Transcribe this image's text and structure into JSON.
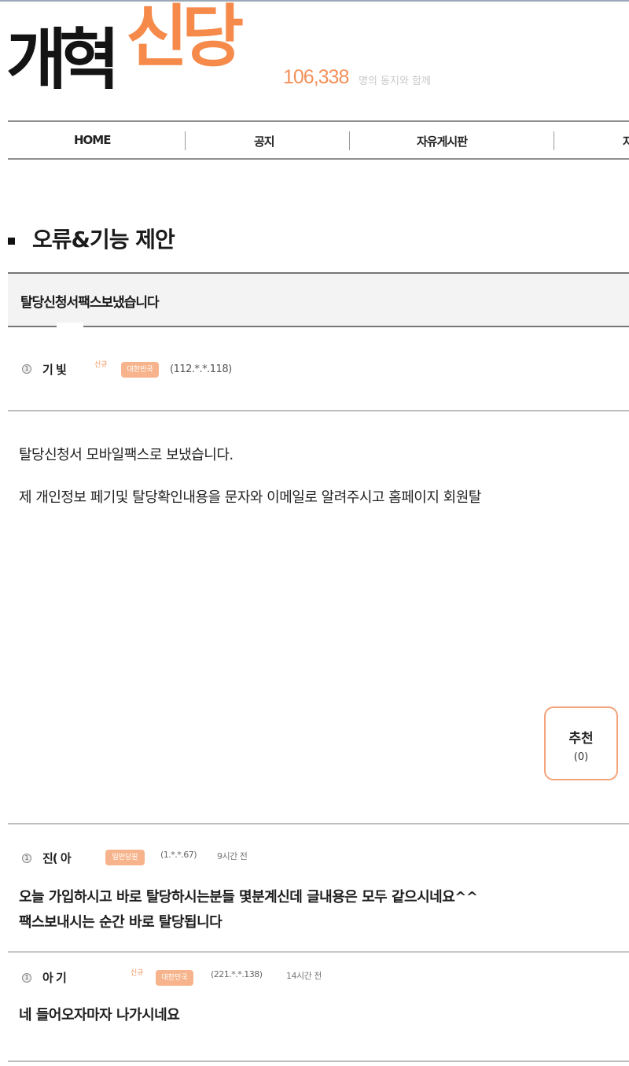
{
  "site": {
    "logo_dark": "개혁",
    "logo_orange": "신당",
    "member_count": "106,338",
    "member_suffix": "명의 동지와 함께"
  },
  "nav": {
    "items": [
      {
        "label": "HOME"
      },
      {
        "label": "공지"
      },
      {
        "label": "자유게시판"
      },
      {
        "label": "자"
      }
    ]
  },
  "board": {
    "title": "오류&기능 제안"
  },
  "post": {
    "subject": "탈당신청서팩스보냈습니다",
    "author": {
      "level": "1",
      "name": "기   빛",
      "sup": "신규",
      "badge": "대한민국",
      "ip": "(112.*.*.118)"
    },
    "body": [
      "탈당신청서 모바일팩스로 보냈습니다.",
      "제 개인정보 페기및 탈당확인내용을 문자와 이메일로 알려주시고 홈페이지 회원탈"
    ],
    "recommend": {
      "label": "추천",
      "count": "(0)"
    }
  },
  "comments": [
    {
      "level": "1",
      "name": "진(     아",
      "badge": "일반당원",
      "ip": "(1.*.*.67)",
      "time": "9시간 전",
      "lines": [
        "오늘 가입하시고 바로 탈당하시는분들 몇분계신데 글내용은 모두 같으시네요^^",
        "팩스보내시는 순간 바로 탈당됩니다"
      ]
    },
    {
      "level": "1",
      "name": "아             기",
      "sup": "신규",
      "badge": "대한민국",
      "ip": "(221.*.*.138)",
      "time": "14시간 전",
      "lines": [
        "네 들어오자마자 나가시네요"
      ]
    }
  ],
  "colors": {
    "accent": "#f58a4b",
    "badge": "#f7b48c",
    "text": "#222222",
    "rule": "#8f8f8f"
  }
}
